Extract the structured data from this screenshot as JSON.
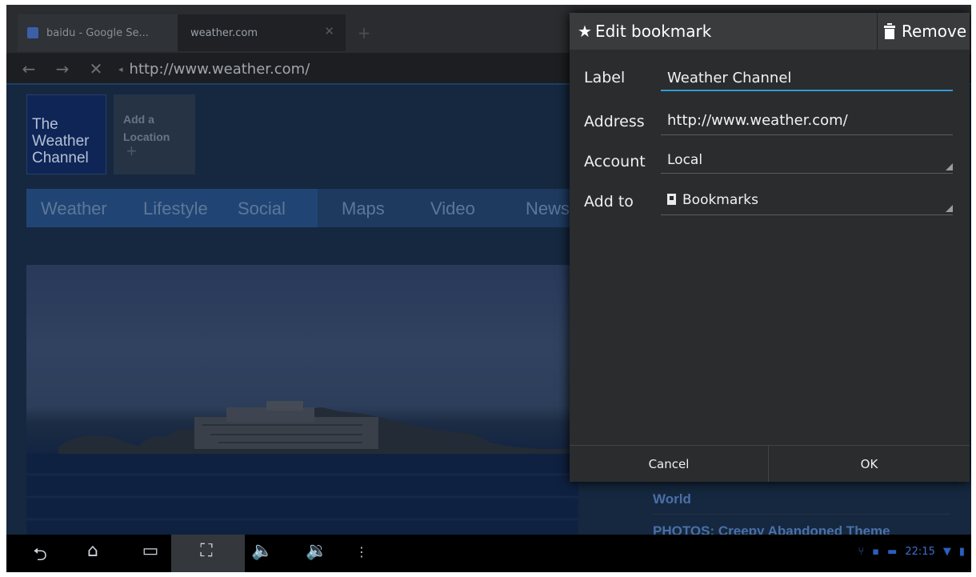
{
  "tabs": [
    {
      "label": "baidu - Google Se..."
    },
    {
      "label": "weather.com"
    }
  ],
  "address_bar": {
    "url": "http://www.weather.com/"
  },
  "page": {
    "logo_lines": [
      "The",
      "Weather",
      "Channel"
    ],
    "add_location": [
      "Add a",
      "Location"
    ],
    "nav_items": [
      "Weather",
      "Lifestyle",
      "Social",
      "Maps",
      "Video",
      "News"
    ],
    "news_items": [
      "World",
      "PHOTOS: Creepy Abandoned Theme"
    ]
  },
  "dialog": {
    "title": "Edit bookmark",
    "remove_label": "Remove",
    "fields": {
      "label": {
        "label": "Label",
        "value": "Weather Channel"
      },
      "address": {
        "label": "Address",
        "value": "http://www.weather.com/"
      },
      "account": {
        "label": "Account",
        "value": "Local"
      },
      "add_to": {
        "label": "Add to",
        "value": "Bookmarks"
      }
    },
    "cancel_label": "Cancel",
    "ok_label": "OK"
  },
  "status": {
    "time": "22:15"
  },
  "icons": {
    "back": "back-arrow-icon",
    "forward": "forward-arrow-icon",
    "stop": "stop-x-icon",
    "star": "star-icon",
    "trash": "trash-icon",
    "bookmark": "bookmark-icon",
    "nav_back": "nav-back-icon",
    "home": "home-icon",
    "recents": "recent-apps-icon",
    "screenshot": "screenshot-icon",
    "vol_down": "volume-down-icon",
    "vol_up": "volume-up-icon",
    "menu": "menu-dots-icon",
    "usb": "usb-icon",
    "wifi": "wifi-icon",
    "battery": "battery-icon"
  },
  "colors": {
    "accent": "#2f9bd6",
    "dialog_bg": "#2b2c2e",
    "title_bar": "#3a3b3d"
  }
}
